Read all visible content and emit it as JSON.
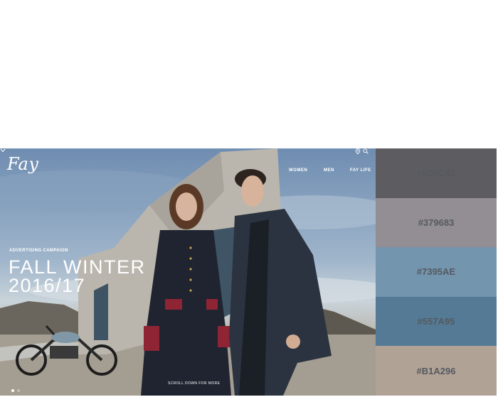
{
  "brand": {
    "logo_text": "Fay"
  },
  "nav": {
    "items": [
      "WOMEN",
      "MEN",
      "FAY LIFE"
    ],
    "icons": [
      "location-pin-icon",
      "search-icon"
    ]
  },
  "hero": {
    "kicker": "ADVERTISING CAMPAIGN",
    "headline_line1": "FALL WINTER",
    "headline_line2": "2016/17",
    "scroll_label": "SCROLL DOWN FOR MORE",
    "slide_dots": {
      "count": 2,
      "active_index": 0
    }
  },
  "palette": {
    "swatches": [
      {
        "hex_label": "#5D5C61",
        "color": "#5D5C61"
      },
      {
        "hex_label": "#379683",
        "color": "#938E94"
      },
      {
        "hex_label": "#7395AE",
        "color": "#7395AE"
      },
      {
        "hex_label": "#557A95",
        "color": "#557A95"
      },
      {
        "hex_label": "#B1A296",
        "color": "#B1A296"
      }
    ]
  }
}
